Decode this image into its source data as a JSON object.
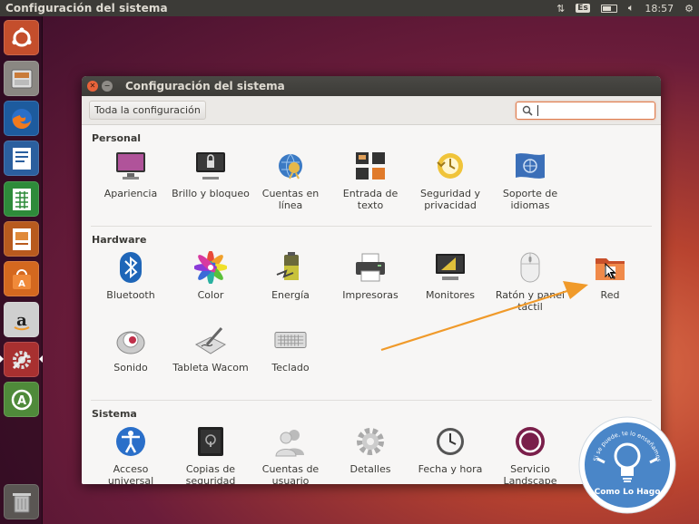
{
  "top_panel": {
    "title": "Configuración del sistema",
    "lang": "Es",
    "clock": "18:57"
  },
  "window": {
    "title": "Configuración del sistema",
    "all_settings": "Toda la configuración",
    "search_placeholder": ""
  },
  "sections": {
    "personal": {
      "title": "Personal",
      "items": [
        {
          "label": "Apariencia",
          "icon": "appearance-icon"
        },
        {
          "label": "Brillo y bloqueo",
          "icon": "brightness-lock-icon"
        },
        {
          "label": "Cuentas en línea",
          "icon": "online-accounts-icon"
        },
        {
          "label": "Entrada de texto",
          "icon": "text-entry-icon"
        },
        {
          "label": "Seguridad y privacidad",
          "icon": "security-privacy-icon"
        },
        {
          "label": "Soporte de idiomas",
          "icon": "language-support-icon"
        }
      ]
    },
    "hardware": {
      "title": "Hardware",
      "items": [
        {
          "label": "Bluetooth",
          "icon": "bluetooth-icon"
        },
        {
          "label": "Color",
          "icon": "color-icon"
        },
        {
          "label": "Energía",
          "icon": "power-icon"
        },
        {
          "label": "Impresoras",
          "icon": "printer-icon"
        },
        {
          "label": "Monitores",
          "icon": "monitor-icon"
        },
        {
          "label": "Ratón y panel táctil",
          "icon": "mouse-icon"
        },
        {
          "label": "Red",
          "icon": "network-icon"
        },
        {
          "label": "Sonido",
          "icon": "sound-icon"
        },
        {
          "label": "Tableta Wacom",
          "icon": "wacom-tablet-icon"
        },
        {
          "label": "Teclado",
          "icon": "keyboard-icon"
        }
      ]
    },
    "system": {
      "title": "Sistema",
      "items": [
        {
          "label": "Acceso universal",
          "icon": "universal-access-icon"
        },
        {
          "label": "Copias de seguridad",
          "icon": "backup-icon"
        },
        {
          "label": "Cuentas de usuario",
          "icon": "user-accounts-icon"
        },
        {
          "label": "Detalles",
          "icon": "details-gear-icon"
        },
        {
          "label": "Fecha y hora",
          "icon": "clock-icon"
        },
        {
          "label": "Servicio Landscape",
          "icon": "landscape-icon"
        }
      ]
    }
  },
  "watermark": {
    "name": "Como Lo Hago",
    "motto": "Si se puede, te lo enseñamos"
  },
  "colors": {
    "accent": "#e07a4a",
    "panel": "#3c3b37",
    "arrow": "#f09a2a"
  }
}
